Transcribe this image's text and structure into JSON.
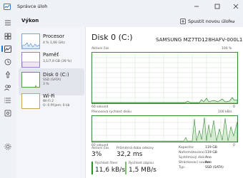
{
  "window": {
    "title": "Správce úloh"
  },
  "toolbar": {
    "heading": "Výkon",
    "new_task_label": "Spustit novou úlohu",
    "more_label": "…"
  },
  "nav_icons": [
    "menu-icon",
    "processes-icon",
    "performance-icon",
    "app-history-icon",
    "startup-icon",
    "users-icon",
    "details-icon",
    "services-icon",
    "settings-icon"
  ],
  "devices": [
    {
      "name": "Procesor",
      "sub": "4 % 1,66 GHz"
    },
    {
      "name": "Paměť",
      "sub": "3,1/7,9 GB (39 %)"
    },
    {
      "name": "Disk 0 (C:)",
      "sub1": "SSD (SATA)",
      "sub2": "3 %",
      "selected": true
    },
    {
      "name": "Wi-Fi",
      "sub1": "Wi-Fi 2",
      "sub2": "O: 0 Přijem: 0 kb"
    }
  ],
  "main": {
    "title": "Disk 0 (C:)",
    "model": "SAMSUNG MZ7TD128HAFV-000L1",
    "graph1": {
      "label": "Aktivní čas",
      "max": "100 %",
      "duration": "60 sekund",
      "min": "0"
    },
    "graph2": {
      "label": "Přenosová rychlost disku",
      "max": "100 kB/s",
      "duration": "60 sekund",
      "min": "0"
    }
  },
  "stats": {
    "active_time_label": "Aktivní čas",
    "active_time_value": "3%",
    "avg_response_label": "Průměrná doba odezvy",
    "avg_response_value": "32,2 ms",
    "read_label": "Rychlost čtení",
    "read_value": "11,6 kB/s",
    "write_label": "Rychlost zápisu",
    "write_value": "1,5 MB/s"
  },
  "properties": [
    {
      "label": "Kapacita:",
      "value": "119 GB"
    },
    {
      "label": "Naformátováno:",
      "value": "119 GB"
    },
    {
      "label": "Systémový disk:",
      "value": "Ano"
    },
    {
      "label": "Stránkovací soubor:",
      "value": "Ano"
    },
    {
      "label": "Typ:",
      "value": "SSD (SATA)"
    }
  ],
  "colors": {
    "accent": "#1a73c8",
    "graph_line": "#3a8a3a",
    "graph_fill": "#d6ecd2"
  }
}
